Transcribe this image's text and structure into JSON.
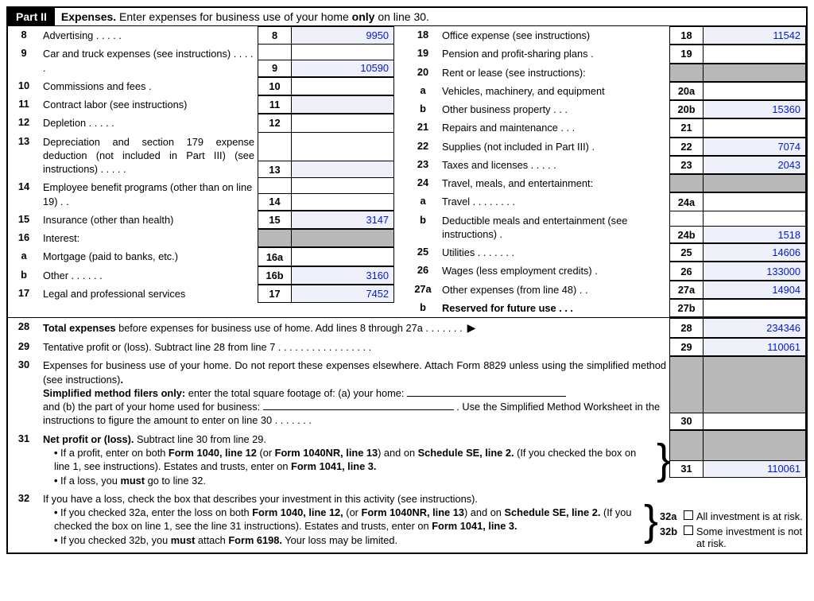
{
  "header": {
    "part": "Part II",
    "title_prefix": "Expenses.",
    "title_rest": " Enter expenses for business use of your home ",
    "title_bold": "only",
    "title_end": " on line 30."
  },
  "left": [
    {
      "n": "8",
      "sub": "",
      "desc": "Advertising .  .  .  .  .",
      "box": "8",
      "val": "9950",
      "bg": "blue"
    },
    {
      "n": "9",
      "sub": "",
      "desc": "Car and truck expenses (see instructions) .  .  .  .  .",
      "box": "9",
      "val": "10590",
      "bg": "blue",
      "tall": true
    },
    {
      "n": "10",
      "sub": "",
      "desc": "Commissions and fees  .",
      "box": "10",
      "val": "",
      "bg": "white"
    },
    {
      "n": "11",
      "sub": "",
      "desc": "Contract labor (see instructions)",
      "box": "11",
      "val": "",
      "bg": "blue"
    },
    {
      "n": "12",
      "sub": "",
      "desc": "Depletion  .  .  .  .  .",
      "box": "12",
      "val": "",
      "bg": "white"
    },
    {
      "n": "13",
      "sub": "",
      "desc": "Depreciation and section 179 expense deduction (not included in Part III) (see instructions) .  .  .  .  .",
      "box": "13",
      "val": "",
      "bg": "blue",
      "tall4": true
    },
    {
      "n": "14",
      "sub": "",
      "desc": "Employee benefit programs (other than on line 19) .  .",
      "box": "14",
      "val": "",
      "bg": "white",
      "tall": true
    },
    {
      "n": "15",
      "sub": "",
      "desc": "Insurance (other than health)",
      "box": "15",
      "val": "3147",
      "bg": "blue"
    },
    {
      "n": "16",
      "sub": "",
      "desc": "Interest:",
      "box": "",
      "val": "",
      "bg": "gray",
      "header": true
    },
    {
      "n": "",
      "sub": "a",
      "desc": "Mortgage (paid to banks, etc.)",
      "box": "16a",
      "val": "",
      "bg": "white"
    },
    {
      "n": "",
      "sub": "b",
      "desc": "Other .  .  .  .  .  .",
      "box": "16b",
      "val": "3160",
      "bg": "blue"
    },
    {
      "n": "17",
      "sub": "",
      "desc": "Legal and professional services",
      "box": "17",
      "val": "7452",
      "bg": "blue"
    }
  ],
  "right": [
    {
      "n": "18",
      "sub": "",
      "desc": "Office expense (see instructions)",
      "box": "18",
      "val": "11542",
      "bg": "blue"
    },
    {
      "n": "19",
      "sub": "",
      "desc": "Pension and profit-sharing plans  .",
      "box": "19",
      "val": "",
      "bg": "white"
    },
    {
      "n": "20",
      "sub": "",
      "desc": "Rent or lease (see instructions):",
      "box": "",
      "val": "",
      "bg": "gray",
      "header": true
    },
    {
      "n": "",
      "sub": "a",
      "desc": "Vehicles, machinery, and equipment",
      "box": "20a",
      "val": "",
      "bg": "white"
    },
    {
      "n": "",
      "sub": "b",
      "desc": "Other business property  .  .  .",
      "box": "20b",
      "val": "15360",
      "bg": "blue"
    },
    {
      "n": "21",
      "sub": "",
      "desc": "Repairs and maintenance .  .  .",
      "box": "21",
      "val": "",
      "bg": "white"
    },
    {
      "n": "22",
      "sub": "",
      "desc": "Supplies (not included in Part III)  .",
      "box": "22",
      "val": "7074",
      "bg": "blue"
    },
    {
      "n": "23",
      "sub": "",
      "desc": "Taxes and licenses .  .  .  .  .",
      "box": "23",
      "val": "2043",
      "bg": "blue"
    },
    {
      "n": "24",
      "sub": "",
      "desc": "Travel, meals, and entertainment:",
      "box": "",
      "val": "",
      "bg": "gray",
      "header": true
    },
    {
      "n": "",
      "sub": "a",
      "desc": "Travel .  .  .  .  .  .  .  .",
      "box": "24a",
      "val": "",
      "bg": "white"
    },
    {
      "n": "",
      "sub": "b",
      "desc": "Deductible meals and entertainment (see instructions)  .",
      "box": "24b",
      "val": "1518",
      "bg": "blue",
      "tall": true
    },
    {
      "n": "25",
      "sub": "",
      "desc": "Utilities  .  .  .  .  .  .  .",
      "box": "25",
      "val": "14606",
      "bg": "blue"
    },
    {
      "n": "26",
      "sub": "",
      "desc": "Wages (less employment credits) .",
      "box": "26",
      "val": "133000",
      "bg": "blue"
    },
    {
      "n": "27a",
      "sub": "",
      "desc": "Other expenses (from line 48)  .  .",
      "box": "27a",
      "val": "14904",
      "bg": "blue"
    },
    {
      "n": "",
      "sub": "b",
      "desc": "Reserved for future use  .  .  .",
      "box": "27b",
      "val": "",
      "bg": "white",
      "bold": true
    }
  ],
  "full": {
    "l28": {
      "n": "28",
      "desc_a": "Total expenses",
      "desc_b": " before expenses for business use of home. Add lines 8 through 27a  .  .  .  .  .  .  .",
      "box": "28",
      "val": "234346"
    },
    "l29": {
      "n": "29",
      "desc": "Tentative profit or (loss). Subtract line 28 from line 7 .  .  .  .  .  .  .  .  .  .  .  .  .  .  .  .  .",
      "box": "29",
      "val": "110061"
    },
    "l30": {
      "n": "30",
      "p1": "Expenses for business use of your home. Do not report these expenses elsewhere. Attach Form 8829 unless using the simplified method (see instructions)",
      "p2a": "Simplified method filers only:",
      "p2b": " enter the total square footage of: (a) your home: ",
      "p3a": "and (b) the part of your home used for business: ",
      "p3b": " . Use the Simplified Method Worksheet in the instructions to figure the amount to enter on line 30  .  .  .  .  .  .  .",
      "box": "30",
      "val": ""
    },
    "l31": {
      "n": "31",
      "h": "Net profit or (loss).",
      "h2": "  Subtract line 30 from line 29.",
      "b1a": "If a profit, enter on both ",
      "b1b": "Form 1040, line 12",
      "b1c": " (or ",
      "b1d": "Form 1040NR, line 13",
      "b1e": ") and on ",
      "b1f": "Schedule SE, line 2.",
      "b1g": " (If you checked the box on line 1, see instructions). Estates and trusts, enter on ",
      "b1h": "Form 1041, line 3.",
      "b2a": "If a loss, you ",
      "b2b": "must",
      "b2c": "  go to line 32.",
      "box": "31",
      "val": "110061"
    },
    "l32": {
      "n": "32",
      "p1": "If you have a loss, check the box that describes your investment in this activity (see instructions).",
      "b1a": "If you checked 32a, enter the loss on both ",
      "b1b": "Form 1040, line 12,",
      "b1c": " (or ",
      "b1d": "Form 1040NR, line 13",
      "b1e": ") and on ",
      "b1f": "Schedule SE, line 2.",
      "b1g": " (If you checked the box on line 1, see the line 31 instructions). Estates and trusts, enter on ",
      "b1h": "Form 1041, line 3.",
      "b2a": "If you checked 32b, you ",
      "b2b": "must",
      "b2c": " attach ",
      "b2d": "Form 6198.",
      "b2e": " Your loss may be limited.",
      "c32a_n": "32a",
      "c32a_t": "All investment is at risk.",
      "c32b_n": "32b",
      "c32b_t": "Some investment is not at risk."
    }
  }
}
